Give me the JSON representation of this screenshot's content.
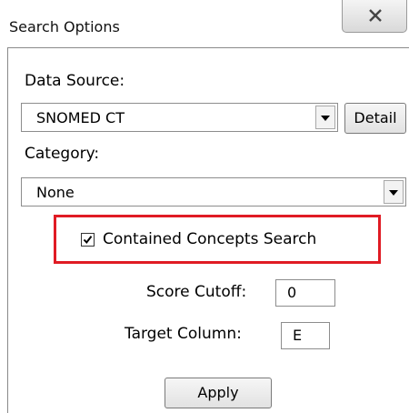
{
  "window": {
    "title": "Search Options",
    "close_icon": "close-x-icon"
  },
  "form": {
    "data_source_label": "Data Source:",
    "data_source_value": "SNOMED CT",
    "detail_button": "Detail",
    "category_label": "Category:",
    "category_value": "None",
    "contained_concepts_label": "Contained Concepts Search",
    "contained_concepts_checked": true,
    "score_cutoff_label": "Score Cutoff:",
    "score_cutoff_value": "0",
    "target_column_label": "Target Column:",
    "target_column_value": "E",
    "apply_button": "Apply"
  },
  "colors": {
    "highlight": "#e01b24",
    "border": "#8d8d8d"
  }
}
